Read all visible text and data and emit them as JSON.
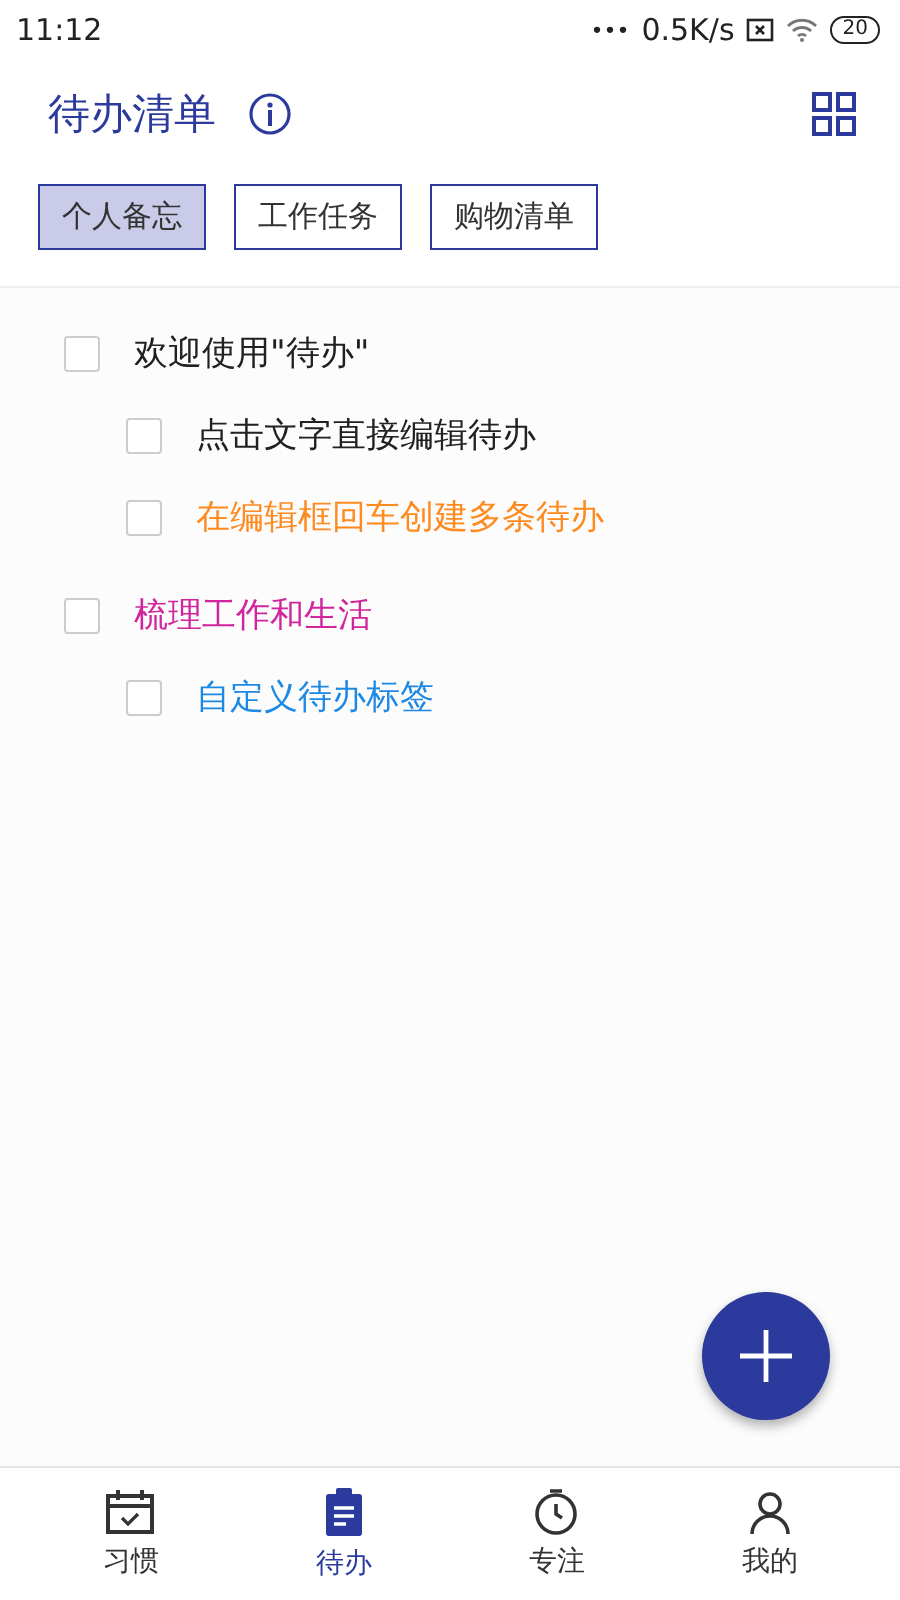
{
  "status_bar": {
    "time": "11:12",
    "dots": "•••",
    "speed": "0.5K/s",
    "battery": "20"
  },
  "header": {
    "title": "待办清单"
  },
  "tags": [
    {
      "label": "个人备忘",
      "selected": true
    },
    {
      "label": "工作任务",
      "selected": false
    },
    {
      "label": "购物清单",
      "selected": false
    }
  ],
  "todos": [
    {
      "text": "欢迎使用\"待办\"",
      "checked": false,
      "color": "#212121",
      "children": [
        {
          "text": "点击文字直接编辑待办",
          "checked": false,
          "color": "#212121"
        },
        {
          "text": "在编辑框回车创建多条待办",
          "checked": false,
          "color": "#ff8a1f"
        }
      ]
    },
    {
      "text": "梳理工作和生活",
      "checked": false,
      "color": "#d0259c",
      "children": [
        {
          "text": "自定义待办标签",
          "checked": false,
          "color": "#1e88e5"
        }
      ]
    }
  ],
  "nav": [
    {
      "kind": "calendar",
      "label": "习惯",
      "selected": false
    },
    {
      "kind": "clipboard",
      "label": "待办",
      "selected": true
    },
    {
      "kind": "timer",
      "label": "专注",
      "selected": false
    },
    {
      "kind": "person",
      "label": "我的",
      "selected": false
    }
  ]
}
